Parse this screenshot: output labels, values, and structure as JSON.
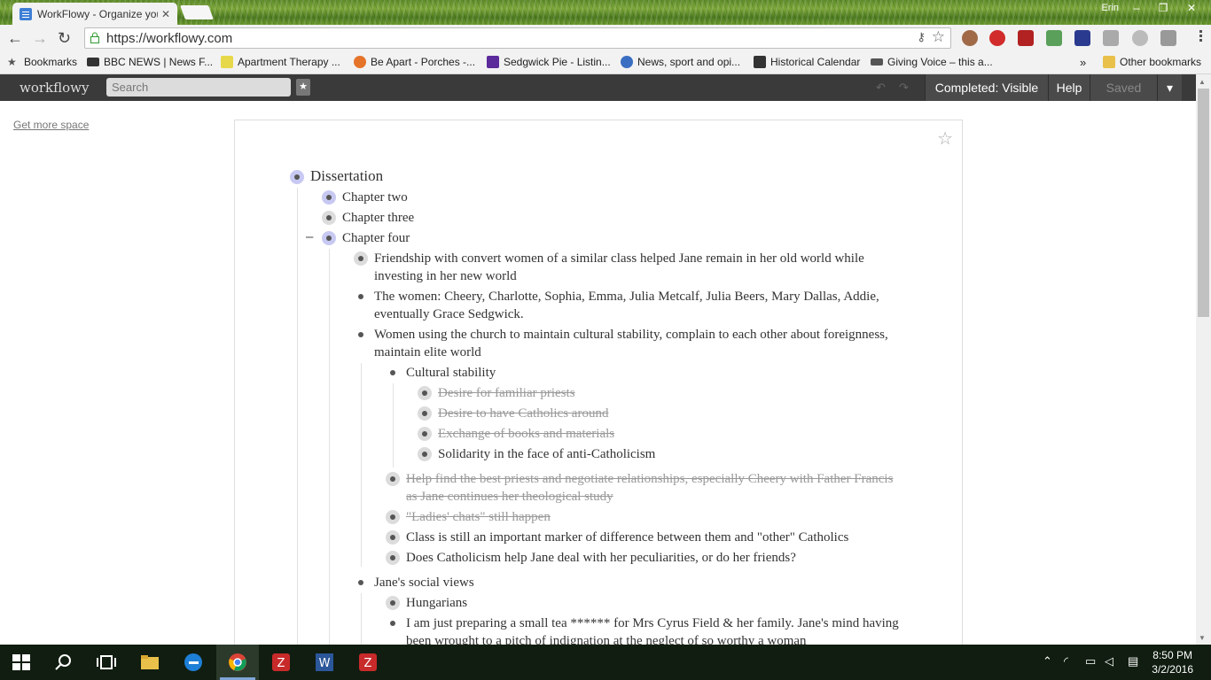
{
  "browser": {
    "tab_title": "WorkFlowy - Organize you",
    "profile_name": "Erin",
    "url": "https://workflowy.com"
  },
  "bookmarks": {
    "items": [
      "Bookmarks",
      "BBC NEWS | News F...",
      "Apartment Therapy ...",
      "Be Apart - Porches -...",
      "Sedgwick Pie - Listin...",
      "News, sport and opi...",
      "Historical Calendar",
      "Giving Voice – this a..."
    ],
    "overflow": "»",
    "other": "Other bookmarks"
  },
  "workflowy": {
    "logo": "workflowy",
    "search_placeholder": "Search",
    "completed_label": "Completed: Visible",
    "help_label": "Help",
    "saved_label": "Saved",
    "get_more_space": "Get more space"
  },
  "outline": [
    {
      "text": "Dissertation"
    },
    {
      "text": "Chapter two"
    },
    {
      "text": "Chapter three"
    },
    {
      "text": "Chapter four"
    },
    {
      "text": "Friendship with convert women of a similar class helped Jane remain in her old world while investing in her new world"
    },
    {
      "text": "The women: Cheery, Charlotte, Sophia, Emma, Julia Metcalf, Julia Beers, Mary Dallas, Addie, eventually Grace Sedgwick."
    },
    {
      "text": "Women using the church to maintain cultural stability, complain to each other about foreignness, maintain elite world"
    },
    {
      "text": "Cultural stability"
    },
    {
      "text": "Desire for familiar priests",
      "completed": true
    },
    {
      "text": "Desire to have Catholics around",
      "completed": true
    },
    {
      "text": "Exchange of books and materials",
      "completed": true
    },
    {
      "text": "Solidarity in the face of anti-Catholicism"
    },
    {
      "text": "Help find the best priests and negotiate relationships, especially Cheery with Father Francis as Jane continues her theological study",
      "completed": true
    },
    {
      "text": "\"Ladies' chats\" still happen",
      "completed": true
    },
    {
      "text": "Class is still an important marker of difference between them and \"other\" Catholics"
    },
    {
      "text": "Does Catholicism help Jane deal with her peculiarities, or do her friends?"
    },
    {
      "text": "Jane's social views"
    },
    {
      "text": "Hungarians"
    },
    {
      "text": "I am just preparing a small tea ****** for Mrs Cyrus Field & her family. Jane's mind having been wrought to a pitch of indignation at the neglect of so worthy a woman"
    }
  ],
  "taskbar": {
    "time": "8:50 PM",
    "date": "3/2/2016"
  }
}
